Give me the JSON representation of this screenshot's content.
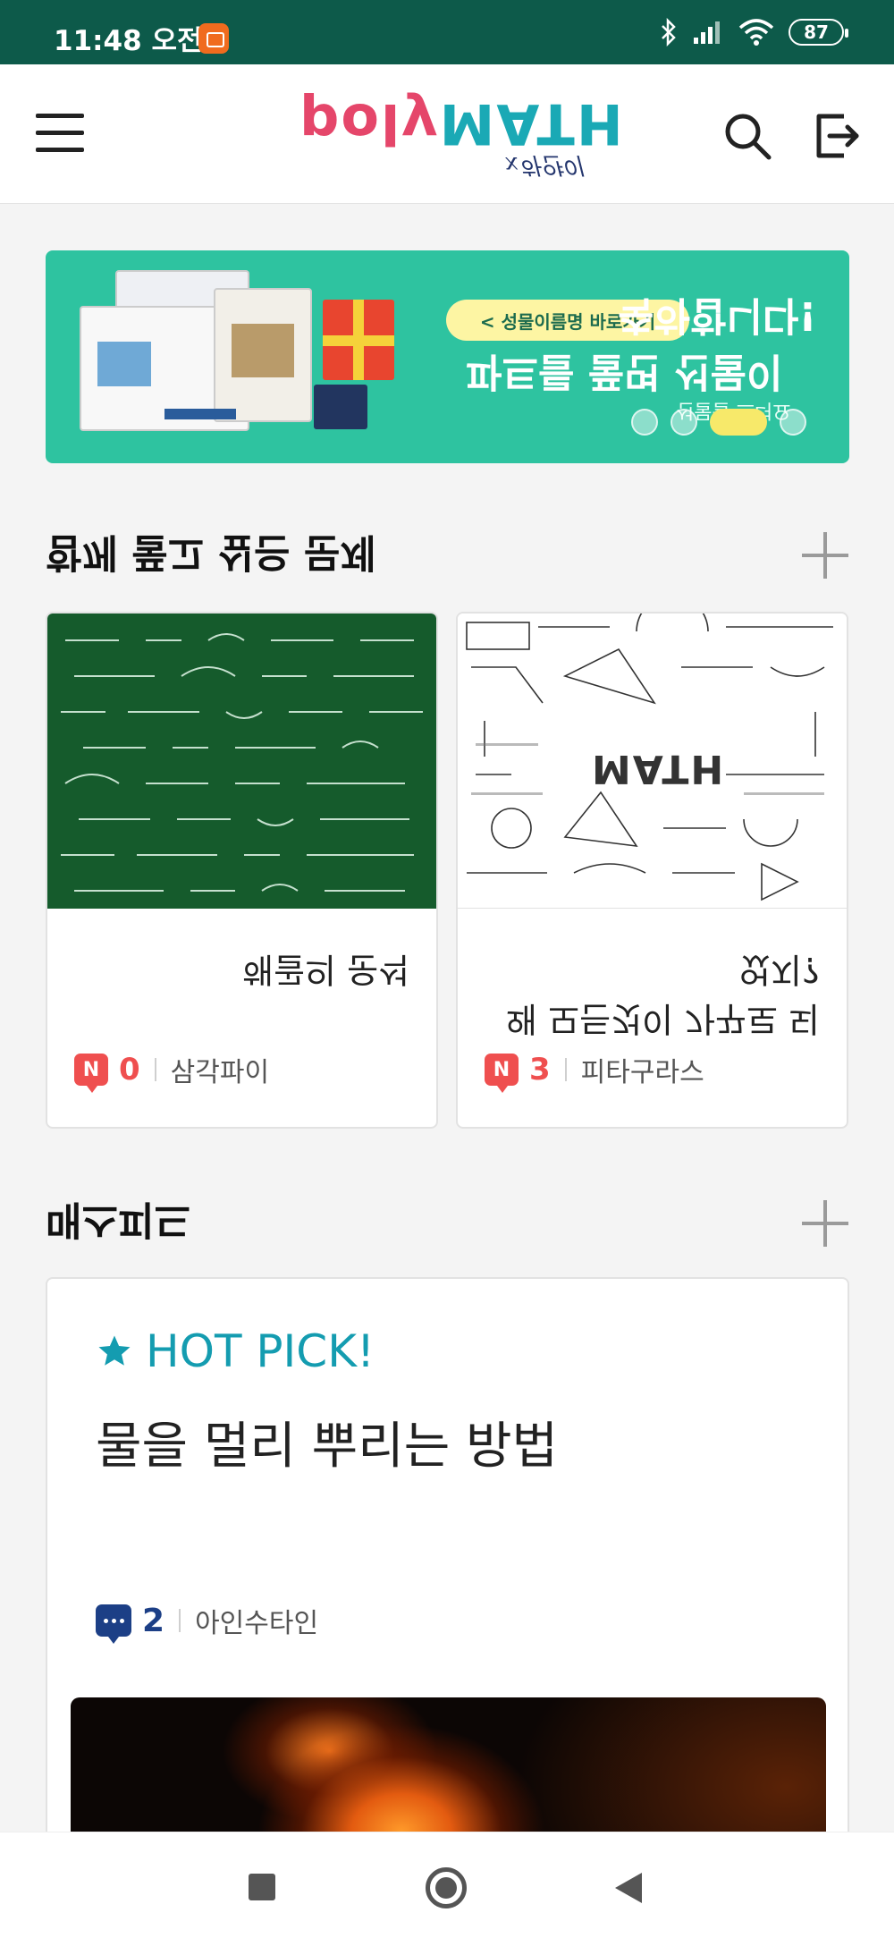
{
  "status_bar": {
    "time": "11:48 오전",
    "battery": "87",
    "icons": [
      "notification-app-icon",
      "bluetooth-icon",
      "signal-icon",
      "wifi-icon",
      "battery-icon"
    ]
  },
  "header": {
    "logo_word_part1": "poly",
    "logo_word_part2": "MATH",
    "logo_sub": "x하얀이",
    "icons": [
      "menu-icon",
      "search-icon",
      "logout-icon"
    ]
  },
  "banner": {
    "pill_text": "< 성물이름명 바로가기",
    "line1": "축하합니다!",
    "line2": "파트를 풀면 선물이",
    "line3": "선물을 드려요",
    "slides": 4,
    "active_slide": 3,
    "colors": {
      "background": "#2ec3a0",
      "pill": "#fdf5a3"
    }
  },
  "section_problems": {
    "title": "함께 풀고 싶은 문제",
    "cards": [
      {
        "title": "해골의 운석",
        "count": "0",
        "author": "삼각파이",
        "badge": "N"
      },
      {
        "title": "왜 모든것이 가꾸로 되었지?",
        "count": "3",
        "author": "피타구라스",
        "badge": "N",
        "thumb_text": "MATH"
      }
    ]
  },
  "section_magazine": {
    "title": "매스피드",
    "hot_label": "HOT PICK!",
    "article_title": "물을 멀리 뿌리는 방법",
    "comment_count": "2",
    "author": "아인수타인"
  },
  "colors": {
    "status_bar": "#0d5a4a",
    "accent_teal": "#149cb0",
    "accent_red": "#ef4f4f",
    "accent_navy": "#1c3f86"
  }
}
